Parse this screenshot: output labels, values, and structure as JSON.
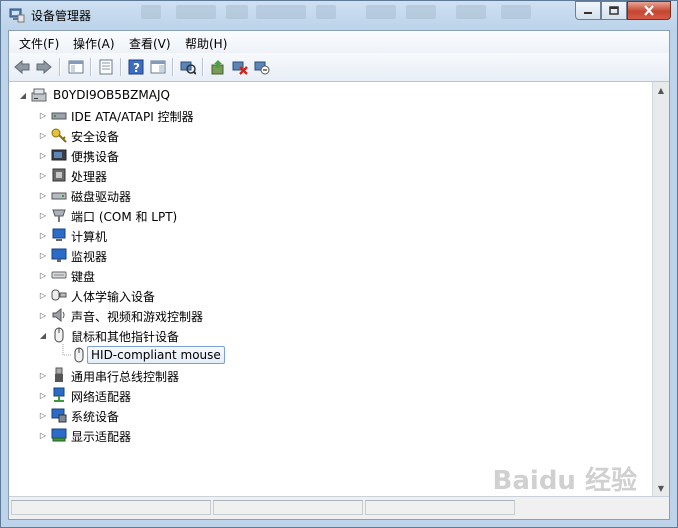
{
  "window": {
    "title": "设备管理器"
  },
  "menu": [
    {
      "label": "文件(F)"
    },
    {
      "label": "操作(A)"
    },
    {
      "label": "查看(V)"
    },
    {
      "label": "帮助(H)"
    }
  ],
  "toolbar": {
    "buttons": [
      "back-icon",
      "forward-icon",
      "show-hide-tree-icon",
      "properties-icon",
      "help-icon",
      "action-pane-icon",
      "scan-hardware-icon",
      "update-driver-icon",
      "uninstall-icon",
      "disable-icon"
    ]
  },
  "tree": {
    "root": "B0YDI9OB5BZMAJQ",
    "items": [
      {
        "label": "IDE ATA/ATAPI 控制器",
        "icon": "ide-controller-icon"
      },
      {
        "label": "安全设备",
        "icon": "security-device-icon"
      },
      {
        "label": "便携设备",
        "icon": "portable-device-icon"
      },
      {
        "label": "处理器",
        "icon": "processor-icon"
      },
      {
        "label": "磁盘驱动器",
        "icon": "disk-drive-icon"
      },
      {
        "label": "端口 (COM 和 LPT)",
        "icon": "port-icon"
      },
      {
        "label": "计算机",
        "icon": "computer-icon"
      },
      {
        "label": "监视器",
        "icon": "monitor-icon"
      },
      {
        "label": "键盘",
        "icon": "keyboard-icon"
      },
      {
        "label": "人体学输入设备",
        "icon": "hid-icon"
      },
      {
        "label": "声音、视频和游戏控制器",
        "icon": "sound-icon"
      },
      {
        "label": "鼠标和其他指针设备",
        "icon": "mouse-icon",
        "expanded": true
      },
      {
        "label": "HID-compliant mouse",
        "icon": "mouse-icon",
        "child": true,
        "selected": true
      },
      {
        "label": "通用串行总线控制器",
        "icon": "usb-icon"
      },
      {
        "label": "网络适配器",
        "icon": "network-adapter-icon"
      },
      {
        "label": "系统设备",
        "icon": "system-device-icon"
      },
      {
        "label": "显示适配器",
        "icon": "display-adapter-icon"
      }
    ]
  },
  "watermark": "Baidu 经验",
  "colors": {
    "title_gradient": "#bcd3ea",
    "selection_border": "#7da2ce",
    "close_button": "#c6452f"
  }
}
